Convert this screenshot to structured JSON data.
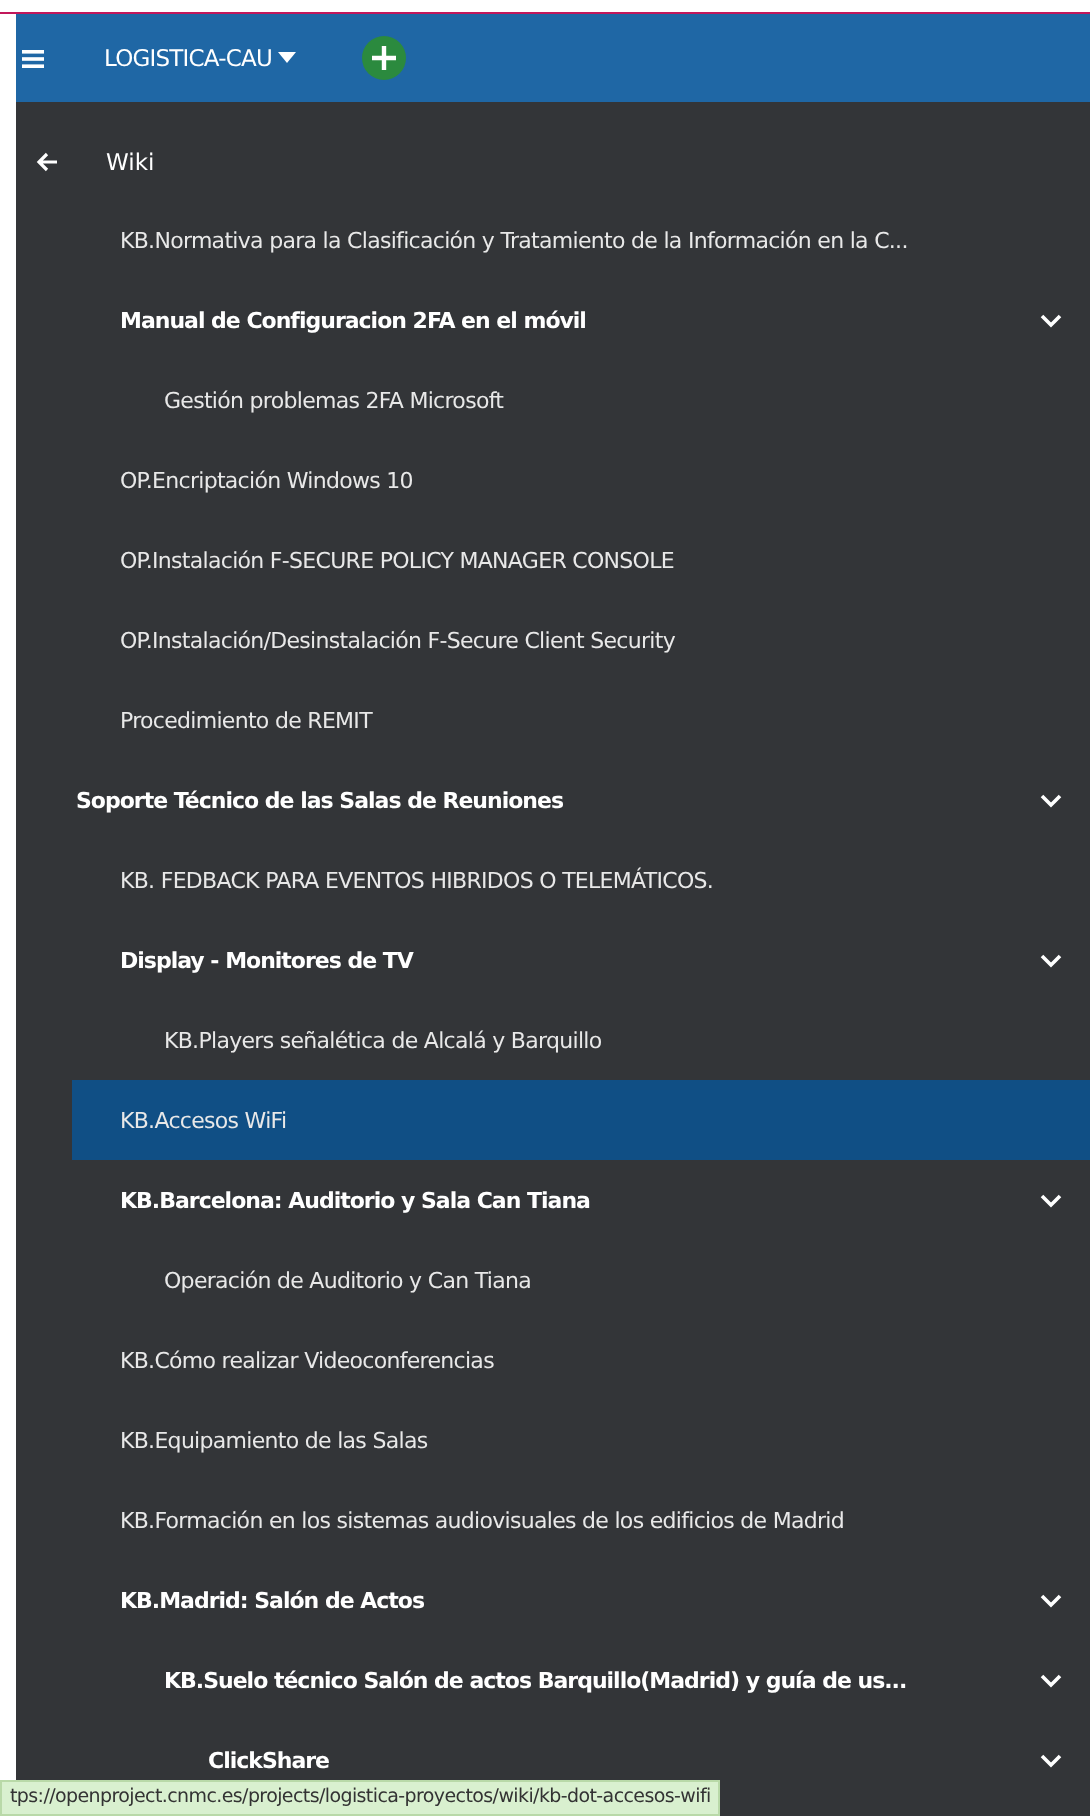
{
  "header": {
    "project": "LOGISTICA-CAU"
  },
  "nav": {
    "title": "Wiki"
  },
  "tree": [
    {
      "children": [
        {
          "label": "KB.Normativa para la Clasificación y Tratamiento de la Información en la C...",
          "kind": "page",
          "selected": false
        },
        {
          "label": "Manual de Configuracion 2FA en el móvil",
          "kind": "folder",
          "expanded": true,
          "selected": false,
          "children": [
            {
              "label": "Gestión problemas 2FA Microsoft",
              "kind": "page",
              "selected": false
            }
          ]
        },
        {
          "label": "OP.Encriptación Windows 10",
          "kind": "page",
          "selected": false
        },
        {
          "label": "OP.Instalación F-SECURE POLICY MANAGER CONSOLE",
          "kind": "page",
          "selected": false
        },
        {
          "label": "OP.Instalación/Desinstalación F-Secure Client Security",
          "kind": "page",
          "selected": false
        },
        {
          "label": "Procedimiento de REMIT",
          "kind": "page",
          "selected": false
        }
      ]
    },
    {
      "label": "Soporte Técnico de las Salas de Reuniones",
      "kind": "folder",
      "expanded": true,
      "selected": false,
      "children": [
        {
          "label": "KB. FEDBACK PARA EVENTOS HIBRIDOS O TELEMÁTICOS.",
          "kind": "page",
          "selected": false
        },
        {
          "label": "Display - Monitores de TV",
          "kind": "folder",
          "expanded": true,
          "selected": false,
          "children": [
            {
              "label": "KB.Players señalética de Alcalá y Barquillo",
              "kind": "page",
              "selected": false
            }
          ]
        },
        {
          "label": "KB.Accesos WiFi",
          "kind": "page",
          "selected": true
        },
        {
          "label": "KB.Barcelona: Auditorio y Sala Can Tiana",
          "kind": "folder",
          "expanded": true,
          "selected": false,
          "children": [
            {
              "label": "Operación de Auditorio y Can Tiana",
              "kind": "page",
              "selected": false
            }
          ]
        },
        {
          "label": "KB.Cómo realizar Videoconferencias",
          "kind": "page",
          "selected": false
        },
        {
          "label": "KB.Equipamiento de las Salas",
          "kind": "page",
          "selected": false
        },
        {
          "label": "KB.Formación en los sistemas audiovisuales de los edificios de Madrid",
          "kind": "page",
          "selected": false
        },
        {
          "label": "KB.Madrid: Salón de Actos",
          "kind": "folder",
          "expanded": true,
          "selected": false,
          "children": [
            {
              "label": "KB.Suelo técnico Salón de actos Barquillo(Madrid) y guía de us...",
              "kind": "folder",
              "expanded": true,
              "selected": false,
              "children": [
                {
                  "label": "ClickShare",
                  "kind": "folder",
                  "expanded": true,
                  "selected": false
                }
              ]
            }
          ]
        }
      ]
    }
  ],
  "status_bar": {
    "url": "tps://openproject.cnmc.es/projects/logistica-proyectos/wiki/kb-dot-accesos-wifi"
  }
}
